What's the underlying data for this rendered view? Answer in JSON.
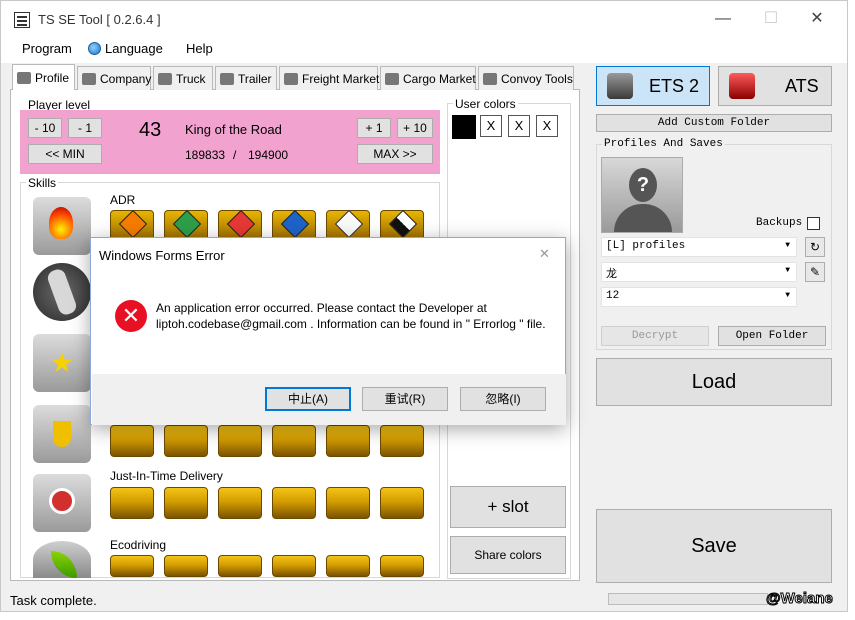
{
  "window": {
    "title": "TS SE Tool [ 0.2.6.4 ]",
    "minimize": "—",
    "maximize": "☐",
    "close": "✕"
  },
  "menu": {
    "program": "Program",
    "language": "Language",
    "help": "Help"
  },
  "tabs": [
    "Profile",
    "Company",
    "Truck",
    "Trailer",
    "Freight Market",
    "Cargo Market",
    "Convoy Tools"
  ],
  "player_level": {
    "label": "Player level",
    "minus10": "- 10",
    "minus1": "- 1",
    "level": "43",
    "title": "King of the Road",
    "plus1": "+ 1",
    "plus10": "+ 10",
    "min_btn": "<< MIN",
    "max_btn": "MAX >>",
    "xp_current": "189833",
    "xp_sep": "/",
    "xp_next": "194900"
  },
  "skills": {
    "label": "Skills",
    "adr": "ADR",
    "jit": "Just-In-Time Delivery",
    "eco": "Ecodriving"
  },
  "user_colors": {
    "label": "User colors",
    "x": "X",
    "add_slot": "+ slot",
    "share": "Share colors"
  },
  "games": {
    "ets2": "ETS 2",
    "ats": "ATS"
  },
  "right": {
    "add_custom_folder": "Add Custom Folder",
    "profiles_label": "Profiles And Saves",
    "backups": "Backups",
    "profile_folder": "[L] profiles",
    "profile_name": "龙",
    "save": "12",
    "decrypt": "Decrypt",
    "open_folder": "Open Folder",
    "load": "Load",
    "save_btn": "Save"
  },
  "status": {
    "text": "Task complete.",
    "watermark": "@Weiane"
  },
  "dialog": {
    "title": "Windows Forms Error",
    "message": "An application error occurred. Please contact the Developer at liptoh.codebase@gmail.com . Information can be found in \" Errorlog \" file.",
    "abort": "中止(A)",
    "retry": "重试(R)",
    "ignore": "忽略(I)",
    "close": "✕"
  },
  "colors": {
    "level_bg": "#f2a2cf",
    "ets_selected": "#cce4f7",
    "error": "#e81123"
  }
}
